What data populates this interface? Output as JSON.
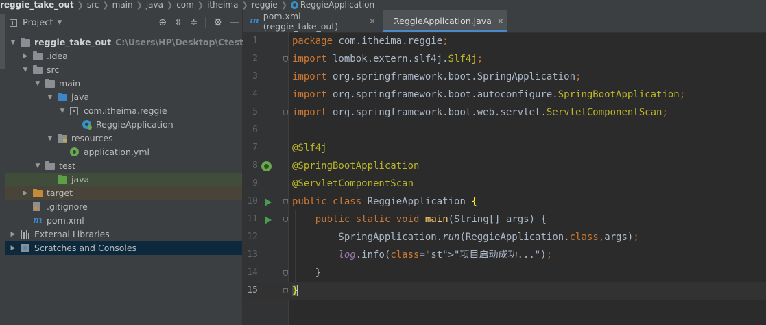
{
  "breadcrumb": {
    "items": [
      "reggie_take_out",
      "src",
      "main",
      "java",
      "com",
      "itheima",
      "reggie",
      "ReggieApplication"
    ]
  },
  "project": {
    "title": "Project",
    "tree": [
      {
        "label": "reggie_take_out",
        "extra": "C:\\Users\\HP\\Desktop\\Ctest\\test\\re",
        "depth": 0,
        "arrow": "down",
        "icon": "folder-gray"
      },
      {
        "label": ".idea",
        "depth": 1,
        "arrow": "right",
        "icon": "folder-gray"
      },
      {
        "label": "src",
        "depth": 1,
        "arrow": "down",
        "icon": "folder-gray"
      },
      {
        "label": "main",
        "depth": 2,
        "arrow": "down",
        "icon": "folder-gray"
      },
      {
        "label": "java",
        "depth": 3,
        "arrow": "down",
        "icon": "folder-blue"
      },
      {
        "label": "com.itheima.reggie",
        "depth": 4,
        "arrow": "down",
        "icon": "package"
      },
      {
        "label": "ReggieApplication",
        "depth": 5,
        "arrow": "",
        "icon": "class"
      },
      {
        "label": "resources",
        "depth": 3,
        "arrow": "down",
        "icon": "folder-resources"
      },
      {
        "label": "application.yml",
        "depth": 4,
        "arrow": "",
        "icon": "yml"
      },
      {
        "label": "test",
        "depth": 2,
        "arrow": "down",
        "icon": "folder-gray"
      },
      {
        "label": "java",
        "depth": 3,
        "arrow": "",
        "icon": "folder-green"
      },
      {
        "label": "target",
        "depth": 1,
        "arrow": "right",
        "icon": "folder-orange"
      },
      {
        "label": ".gitignore",
        "depth": 1,
        "arrow": "",
        "icon": "gitignore"
      },
      {
        "label": "pom.xml",
        "depth": 1,
        "arrow": "",
        "icon": "maven"
      },
      {
        "label": "External Libraries",
        "depth": 0,
        "arrow": "right",
        "icon": "libraries"
      },
      {
        "label": "Scratches and Consoles",
        "depth": 0,
        "arrow": "right",
        "icon": "scratches"
      }
    ]
  },
  "tabs": [
    {
      "label": "pom.xml (reggie_take_out)",
      "icon": "maven",
      "active": false
    },
    {
      "label": "ReggieApplication.java",
      "icon": "class",
      "active": true
    }
  ],
  "code": {
    "lines": [
      "package com.itheima.reggie;",
      "import lombok.extern.slf4j.Slf4j;",
      "import org.springframework.boot.SpringApplication;",
      "import org.springframework.boot.autoconfigure.SpringBootApplication;",
      "import org.springframework.boot.web.servlet.ServletComponentScan;",
      "",
      "@Slf4j",
      "@SpringBootApplication",
      "@ServletComponentScan",
      "public class ReggieApplication {",
      "    public static void main(String[] args) {",
      "        SpringApplication.run(ReggieApplication.class,args);",
      "        log.info(\"项目启动成功...\");",
      "    }",
      "}"
    ],
    "line_numbers": [
      "1",
      "2",
      "3",
      "4",
      "5",
      "6",
      "7",
      "8",
      "9",
      "10",
      "11",
      "12",
      "13",
      "14",
      "15"
    ],
    "current_line": 15
  }
}
